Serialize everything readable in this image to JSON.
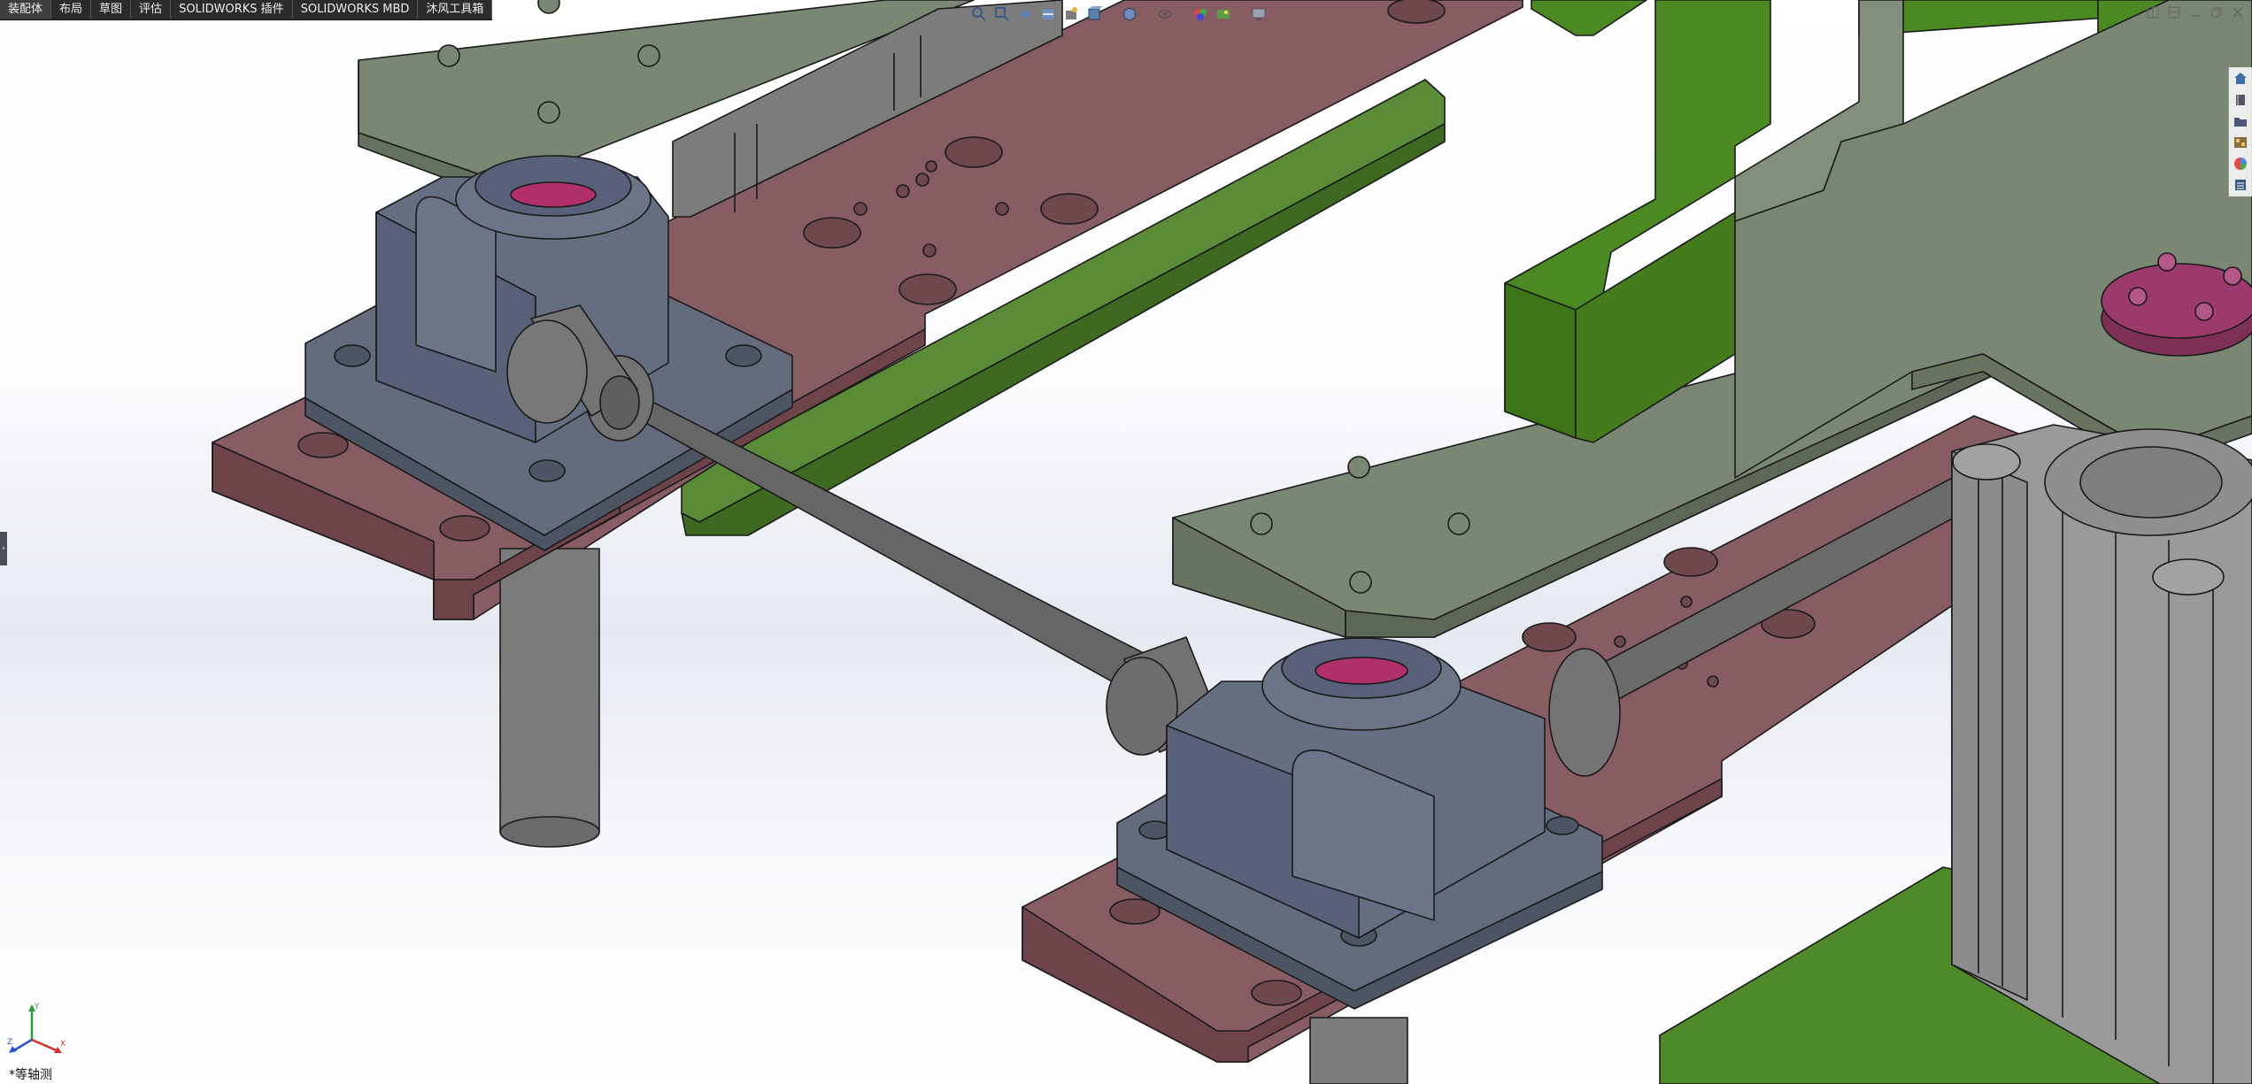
{
  "command_tabs": [
    {
      "label": "装配体"
    },
    {
      "label": "布局"
    },
    {
      "label": "草图"
    },
    {
      "label": "评估"
    },
    {
      "label": "SOLIDWORKS 插件"
    },
    {
      "label": "SOLIDWORKS MBD"
    },
    {
      "label": "沐风工具箱"
    }
  ],
  "active_tab": "装配体",
  "hud_toolbar_icons": [
    "zoom-to-fit-icon",
    "zoom-to-area-icon",
    "previous-view-icon",
    "section-view-icon",
    "dynamic-annotation-icon",
    "view-orientation-icon",
    "display-style-icon",
    "hide-show-items-icon",
    "edit-appearance-icon",
    "apply-scene-icon",
    "view-settings-icon"
  ],
  "task_pane_icons": [
    "home-icon",
    "design-library-icon",
    "file-explorer-icon",
    "view-palette-icon",
    "appearances-icon",
    "custom-properties-icon"
  ],
  "view_orientation_label": "*等轴测",
  "triad_axes": {
    "x": "X",
    "y": "Y",
    "z": "Z"
  },
  "colors": {
    "plate_maroon": "#875c62",
    "bearing_block": "#646c7e",
    "frame_green": "#4b8a22",
    "plate_sage": "#7a8772",
    "shaft_gray": "#737373",
    "accent_magenta": "#b0306a",
    "tab_bar": "#2b2b2b",
    "viewport_band": "#e6e9f1"
  }
}
